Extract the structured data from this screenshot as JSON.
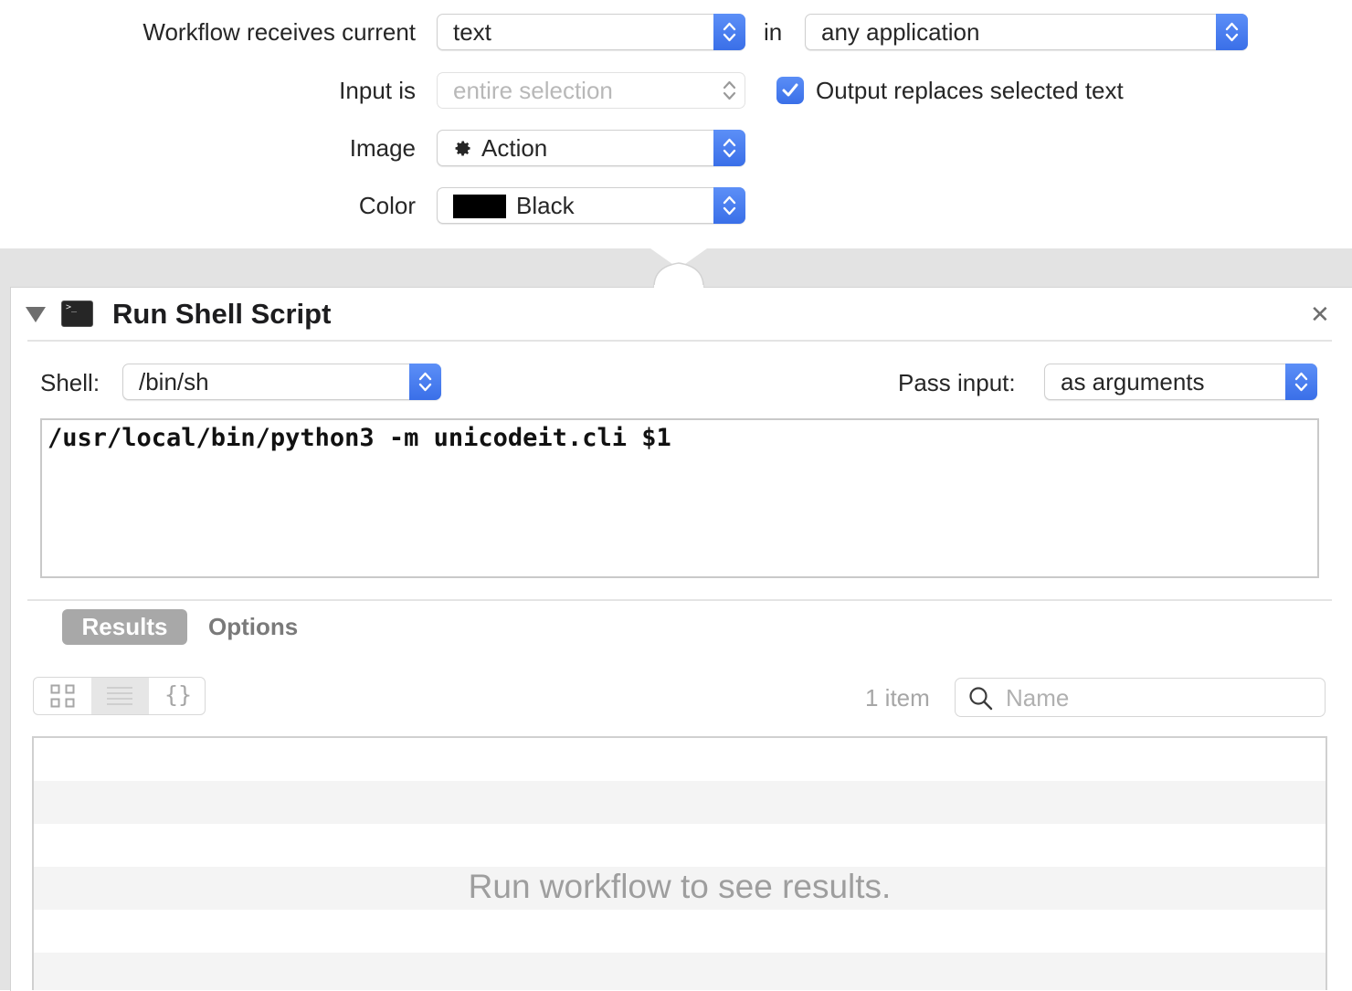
{
  "workflow": {
    "receives_label": "Workflow receives current",
    "receives_value": "text",
    "in_label": "in",
    "application_value": "any application",
    "input_label": "Input is",
    "input_value": "entire selection",
    "output_replaces_label": "Output replaces selected text",
    "output_replaces_checked": true,
    "image_label": "Image",
    "image_value": "Action",
    "image_icon": "gear-icon",
    "color_label": "Color",
    "color_value": "Black",
    "color_swatch": "#000000"
  },
  "action": {
    "title": "Run Shell Script",
    "shell_label": "Shell:",
    "shell_value": "/bin/sh",
    "pass_input_label": "Pass input:",
    "pass_input_value": "as arguments",
    "script": "/usr/local/bin/python3 -m unicodeit.cli $1"
  },
  "results": {
    "tabs": [
      {
        "label": "Results",
        "active": true
      },
      {
        "label": "Options",
        "active": false
      }
    ],
    "view_modes": [
      "grid-view-icon",
      "list-view-icon",
      "json-view-icon"
    ],
    "selected_view": "list-view-icon",
    "item_count": "1 item",
    "search_placeholder": "Name",
    "empty_message": "Run workflow to see results."
  },
  "colors": {
    "accent": "#3a6fe8",
    "tab_active_bg": "#a8a8a8"
  }
}
